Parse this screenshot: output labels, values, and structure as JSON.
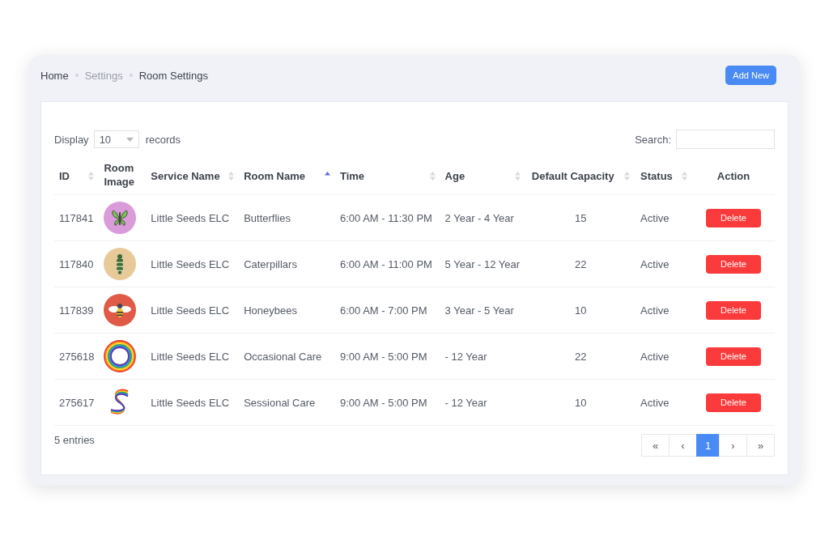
{
  "breadcrumb": [
    {
      "label": "Home",
      "kind": "link"
    },
    {
      "label": "Settings",
      "kind": "muted"
    },
    {
      "label": "Room Settings",
      "kind": "current"
    }
  ],
  "add_button": "Add New",
  "display": {
    "label": "Display",
    "value": "10",
    "suffix": "records"
  },
  "search": {
    "label": "Search:"
  },
  "table": {
    "columns": [
      {
        "label": "ID",
        "sortable": true,
        "sorted_ascending": false
      },
      {
        "label": "Room Image",
        "sortable": false
      },
      {
        "label": "Service Name",
        "sortable": true,
        "sorted_ascending": false
      },
      {
        "label": "Room Name",
        "sortable": true,
        "sorted_ascending": true
      },
      {
        "label": "Time",
        "sortable": true,
        "sorted_ascending": false
      },
      {
        "label": "Age",
        "sortable": true,
        "sorted_ascending": false
      },
      {
        "label": "Default Capacity",
        "sortable": true,
        "sorted_ascending": false
      },
      {
        "label": "Status",
        "sortable": true,
        "sorted_ascending": false
      },
      {
        "label": "Action",
        "sortable": false
      }
    ],
    "rows": [
      {
        "id": "117841",
        "kind": "butterfly",
        "service": "Little Seeds ELC",
        "room": "Butterflies",
        "time": "6:00 AM - 11:30 PM",
        "age": "2 Year - 4 Year",
        "capacity": "15",
        "status": "Active",
        "action": "Delete"
      },
      {
        "id": "117840",
        "kind": "caterpillar",
        "service": "Little Seeds ELC",
        "room": "Caterpillars",
        "time": "6:00 AM - 11:00 PM",
        "age": "5 Year - 12 Year",
        "capacity": "22",
        "status": "Active",
        "action": "Delete"
      },
      {
        "id": "117839",
        "kind": "bee",
        "service": "Little Seeds ELC",
        "room": "Honeybees",
        "time": "6:00 AM - 7:00 PM",
        "age": "3 Year - 5 Year",
        "capacity": "10",
        "status": "Active",
        "action": "Delete"
      },
      {
        "id": "275618",
        "kind": "ring",
        "service": "Little Seeds ELC",
        "room": "Occasional Care",
        "time": "9:00 AM - 5:00 PM",
        "age": "- 12 Year",
        "capacity": "22",
        "status": "Active",
        "action": "Delete"
      },
      {
        "id": "275617",
        "kind": "wave",
        "service": "Little Seeds ELC",
        "room": "Sessional Care",
        "time": "9:00 AM - 5:00 PM",
        "age": "- 12 Year",
        "capacity": "10",
        "status": "Active",
        "action": "Delete"
      }
    ]
  },
  "entries": "5 entries",
  "pagination": [
    {
      "label": "«",
      "selected": false
    },
    {
      "label": "‹",
      "selected": false
    },
    {
      "label": "1",
      "selected": true
    },
    {
      "label": "›",
      "selected": false
    },
    {
      "label": "»",
      "selected": false
    }
  ]
}
